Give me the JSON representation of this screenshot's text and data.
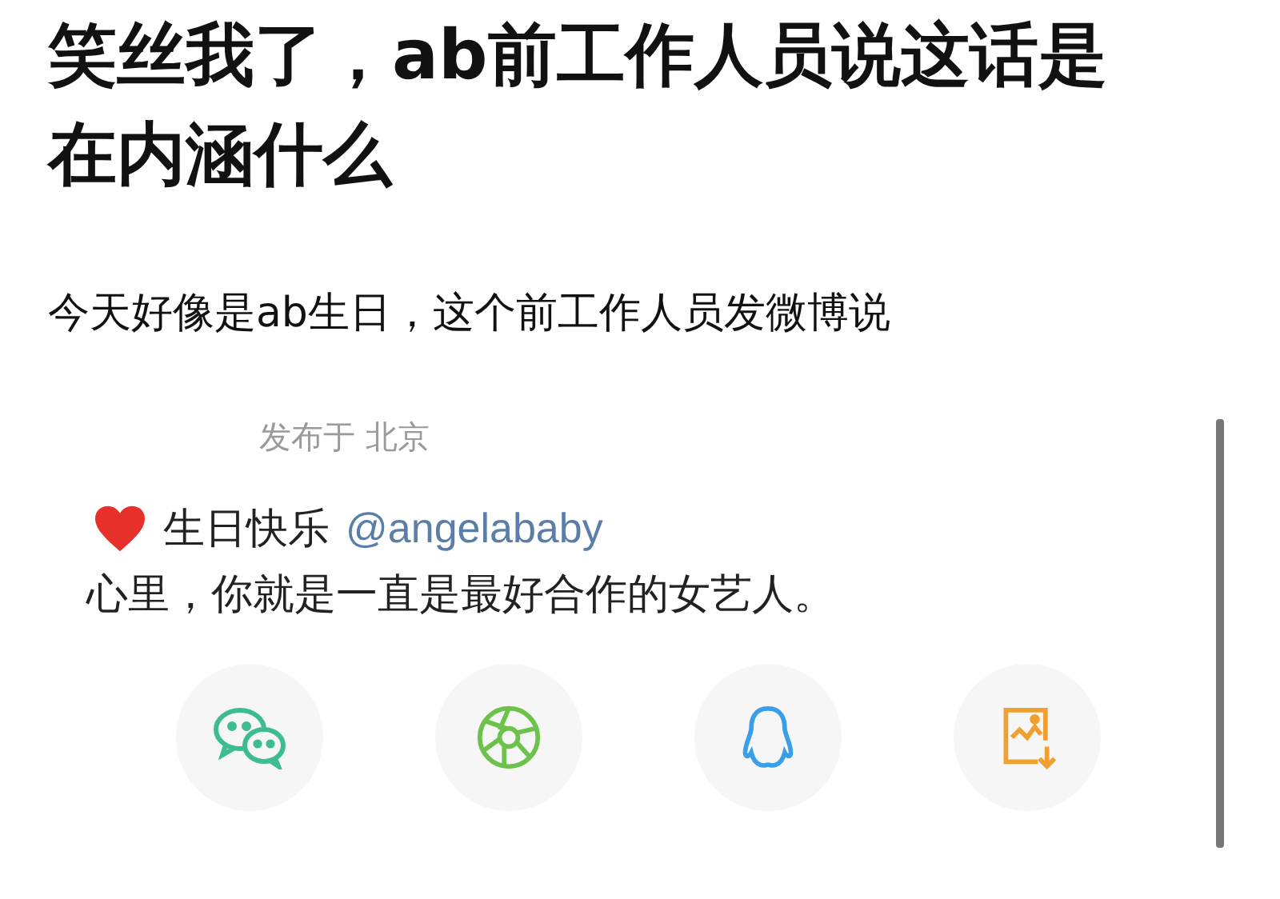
{
  "title": "笑丝我了，ab前工作人员说这话是在内涵什么",
  "intro": "今天好像是ab生日，这个前工作人员发微博说",
  "post": {
    "location": "发布于 北京",
    "greeting": "生日快乐",
    "mention": "@angelababy",
    "body": "心里，你就是一直是最好合作的女艺人。"
  },
  "share_buttons": [
    {
      "kind": "wechat"
    },
    {
      "kind": "moments"
    },
    {
      "kind": "qq"
    },
    {
      "kind": "save-image"
    }
  ]
}
